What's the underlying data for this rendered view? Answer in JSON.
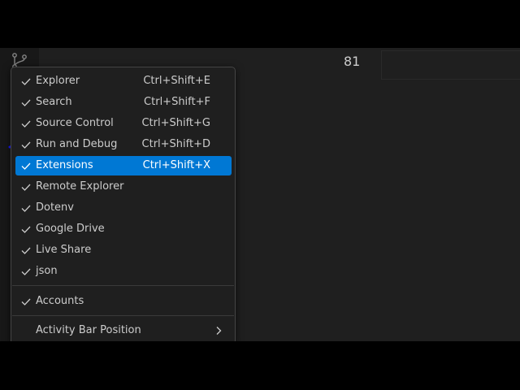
{
  "editor": {
    "line_number": "81"
  },
  "colors": {
    "highlight": "#0078d4",
    "menu_background": "#1f1f1f",
    "text": "#cccccc"
  },
  "context_menu": {
    "items": [
      {
        "label": "Explorer",
        "shortcut": "Ctrl+Shift+E",
        "checked": true
      },
      {
        "label": "Search",
        "shortcut": "Ctrl+Shift+F",
        "checked": true
      },
      {
        "label": "Source Control",
        "shortcut": "Ctrl+Shift+G",
        "checked": true
      },
      {
        "label": "Run and Debug",
        "shortcut": "Ctrl+Shift+D",
        "checked": true
      },
      {
        "label": "Extensions",
        "shortcut": "Ctrl+Shift+X",
        "checked": true,
        "highlighted": true
      },
      {
        "label": "Remote Explorer",
        "shortcut": "",
        "checked": true
      },
      {
        "label": "Dotenv",
        "shortcut": "",
        "checked": true
      },
      {
        "label": "Google Drive",
        "shortcut": "",
        "checked": true
      },
      {
        "label": "Live Share",
        "shortcut": "",
        "checked": true
      },
      {
        "label": "json",
        "shortcut": "",
        "checked": true
      }
    ],
    "accounts": {
      "label": "Accounts",
      "checked": true
    },
    "activity_bar_position": {
      "label": "Activity Bar Position",
      "submenu_icon": "chevron-right-icon"
    }
  }
}
